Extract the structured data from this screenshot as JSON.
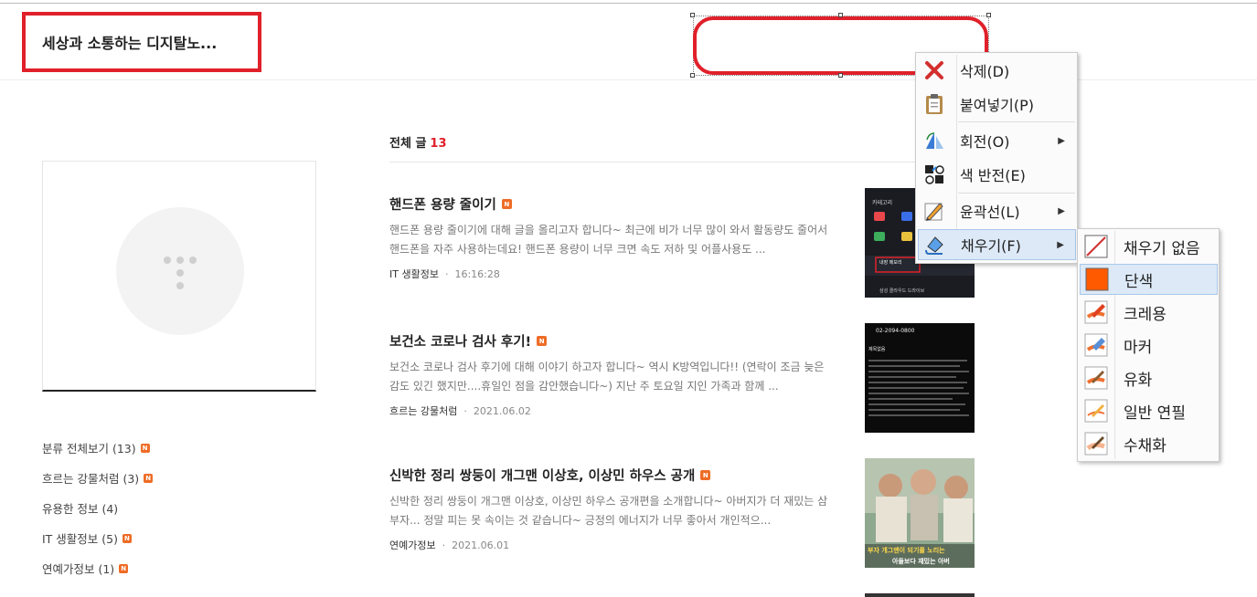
{
  "blog": {
    "title": "세상과 소통하는 디지탈노..."
  },
  "sidebar": {
    "categories": [
      {
        "label": "분류 전체보기 (13)",
        "new": true
      },
      {
        "label": "흐르는 강물처럼 (3)",
        "new": true
      },
      {
        "label": "유용한 정보 (4)",
        "new": false
      },
      {
        "label": "IT 생활정보 (5)",
        "new": true
      },
      {
        "label": "연예가정보 (1)",
        "new": true
      }
    ],
    "new_badge": "N"
  },
  "main": {
    "total_label": "전체 글",
    "total_count": "13",
    "posts": [
      {
        "title": "핸드폰 용량 줄이기",
        "excerpt": "핸드폰 용량 줄이기에 대해 글을 올리고자 합니다~ 최근에 비가 너무 많이 와서 활동량도 줄어서 핸드폰을 자주 사용하는데요! 핸드폰 용량이 너무 크면 속도 저하 및 어플사용도 ...",
        "category": "IT 생활정보",
        "date": "16:16:28",
        "thumb_text": [
          "카테고리",
          "내장 메모리",
          "삼성 클라우드 드라이브"
        ]
      },
      {
        "title": "보건소 코로나 검사 후기!",
        "excerpt": "보건소 코로나 검사 후기에 대해 이야기 하고자 합니다~ 역시 K방역입니다!! (연락이 조금 늦은 감도 있긴 했지만....휴일인 점을 감안했습니다~) 지난 주 토요일 지인 가족과 함께 ...",
        "category": "흐르는 강물처럼",
        "date": "2021.06.02",
        "thumb_text": [
          "02-2094-0800",
          "제목없음"
        ]
      },
      {
        "title": "신박한 정리 쌍둥이 개그맨 이상호, 이상민 하우스 공개",
        "excerpt": "신박한 정리 쌍둥이 개그맨 이상호, 이상민 하우스 공개편을 소개합니다~ 아버지가 더 재밌는 삼부자... 정말 피는 못 속이는 것 같습니다~ 긍정의 에너지가 너무 좋아서 개인적으...",
        "category": "연예가정보",
        "date": "2021.06.01",
        "thumb_text": [
          "부자 개그맨이 되기를 노리는",
          "아들보다 재밌는 아버"
        ]
      }
    ],
    "meta_sep": "·"
  },
  "context_menu": {
    "items": [
      {
        "label": "삭제(D)",
        "icon": "delete-x-icon",
        "has_submenu": false
      },
      {
        "label": "붙여넣기(P)",
        "icon": "paste-icon",
        "has_submenu": false
      },
      {
        "label": "회전(O)",
        "icon": "rotate-icon",
        "has_submenu": true
      },
      {
        "label": "색 반전(E)",
        "icon": "invert-color-icon",
        "has_submenu": false
      },
      {
        "label": "윤곽선(L)",
        "icon": "outline-pencil-icon",
        "has_submenu": true
      },
      {
        "label": "채우기(F)",
        "icon": "fill-bucket-icon",
        "has_submenu": true,
        "highlighted": true
      }
    ],
    "submenu_arrow": "▶"
  },
  "fill_submenu": {
    "items": [
      {
        "label": "채우기 없음",
        "icon": "no-fill-icon"
      },
      {
        "label": "단색",
        "icon": "solid-color-icon",
        "highlighted": true
      },
      {
        "label": "크레용",
        "icon": "crayon-icon"
      },
      {
        "label": "마커",
        "icon": "marker-icon"
      },
      {
        "label": "유화",
        "icon": "oil-paint-icon"
      },
      {
        "label": "일반 연필",
        "icon": "pencil-icon"
      },
      {
        "label": "수채화",
        "icon": "watercolor-icon"
      }
    ]
  },
  "colors": {
    "accent_red": "#e0202a",
    "solid_fill": "#ff5a00",
    "new_badge": "#ee6c26",
    "menu_highlight": "#dde9f7"
  }
}
